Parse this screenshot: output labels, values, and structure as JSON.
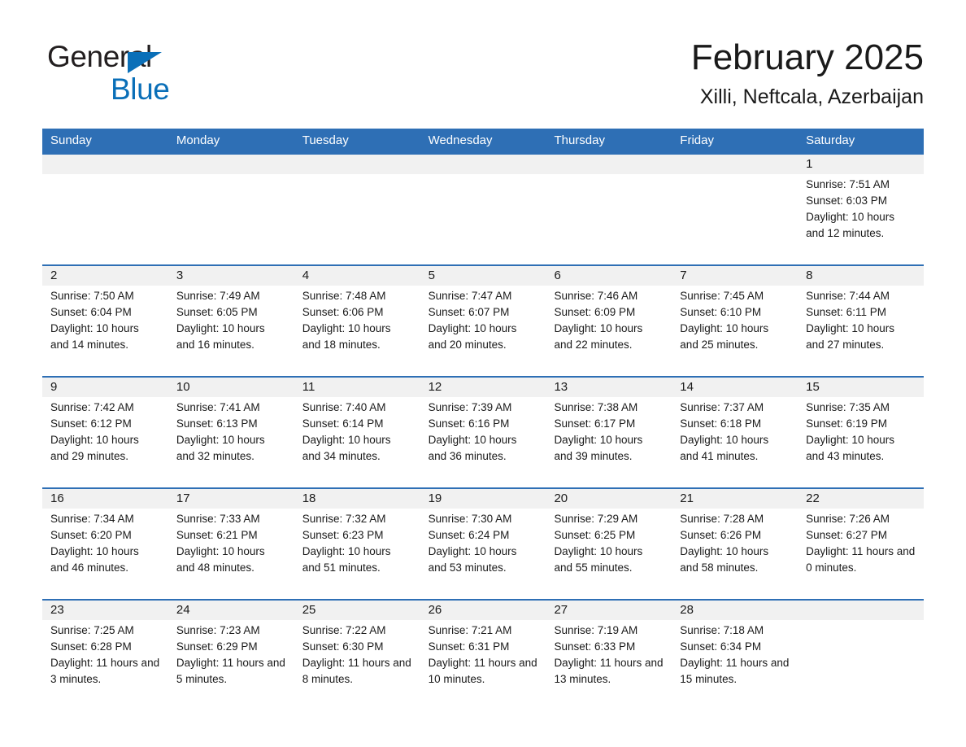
{
  "brand": {
    "name_part1": "General",
    "name_part2": "Blue",
    "triangle_color": "#0a6fb8"
  },
  "header": {
    "title": "February 2025",
    "subtitle": "Xilli, Neftcala, Azerbaijan",
    "accent_color": "#2e6fb5",
    "daynum_band_color": "#f1f1f1"
  },
  "weekdays": [
    "Sunday",
    "Monday",
    "Tuesday",
    "Wednesday",
    "Thursday",
    "Friday",
    "Saturday"
  ],
  "weeks": [
    {
      "days": [
        {
          "date": "",
          "sunrise": "",
          "sunset": "",
          "daylight": "",
          "empty": true
        },
        {
          "date": "",
          "sunrise": "",
          "sunset": "",
          "daylight": "",
          "empty": true
        },
        {
          "date": "",
          "sunrise": "",
          "sunset": "",
          "daylight": "",
          "empty": true
        },
        {
          "date": "",
          "sunrise": "",
          "sunset": "",
          "daylight": "",
          "empty": true
        },
        {
          "date": "",
          "sunrise": "",
          "sunset": "",
          "daylight": "",
          "empty": true
        },
        {
          "date": "",
          "sunrise": "",
          "sunset": "",
          "daylight": "",
          "empty": true
        },
        {
          "date": "1",
          "sunrise": "Sunrise: 7:51 AM",
          "sunset": "Sunset: 6:03 PM",
          "daylight": "Daylight: 10 hours and 12 minutes.",
          "empty": false
        }
      ]
    },
    {
      "days": [
        {
          "date": "2",
          "sunrise": "Sunrise: 7:50 AM",
          "sunset": "Sunset: 6:04 PM",
          "daylight": "Daylight: 10 hours and 14 minutes.",
          "empty": false
        },
        {
          "date": "3",
          "sunrise": "Sunrise: 7:49 AM",
          "sunset": "Sunset: 6:05 PM",
          "daylight": "Daylight: 10 hours and 16 minutes.",
          "empty": false
        },
        {
          "date": "4",
          "sunrise": "Sunrise: 7:48 AM",
          "sunset": "Sunset: 6:06 PM",
          "daylight": "Daylight: 10 hours and 18 minutes.",
          "empty": false
        },
        {
          "date": "5",
          "sunrise": "Sunrise: 7:47 AM",
          "sunset": "Sunset: 6:07 PM",
          "daylight": "Daylight: 10 hours and 20 minutes.",
          "empty": false
        },
        {
          "date": "6",
          "sunrise": "Sunrise: 7:46 AM",
          "sunset": "Sunset: 6:09 PM",
          "daylight": "Daylight: 10 hours and 22 minutes.",
          "empty": false
        },
        {
          "date": "7",
          "sunrise": "Sunrise: 7:45 AM",
          "sunset": "Sunset: 6:10 PM",
          "daylight": "Daylight: 10 hours and 25 minutes.",
          "empty": false
        },
        {
          "date": "8",
          "sunrise": "Sunrise: 7:44 AM",
          "sunset": "Sunset: 6:11 PM",
          "daylight": "Daylight: 10 hours and 27 minutes.",
          "empty": false
        }
      ]
    },
    {
      "days": [
        {
          "date": "9",
          "sunrise": "Sunrise: 7:42 AM",
          "sunset": "Sunset: 6:12 PM",
          "daylight": "Daylight: 10 hours and 29 minutes.",
          "empty": false
        },
        {
          "date": "10",
          "sunrise": "Sunrise: 7:41 AM",
          "sunset": "Sunset: 6:13 PM",
          "daylight": "Daylight: 10 hours and 32 minutes.",
          "empty": false
        },
        {
          "date": "11",
          "sunrise": "Sunrise: 7:40 AM",
          "sunset": "Sunset: 6:14 PM",
          "daylight": "Daylight: 10 hours and 34 minutes.",
          "empty": false
        },
        {
          "date": "12",
          "sunrise": "Sunrise: 7:39 AM",
          "sunset": "Sunset: 6:16 PM",
          "daylight": "Daylight: 10 hours and 36 minutes.",
          "empty": false
        },
        {
          "date": "13",
          "sunrise": "Sunrise: 7:38 AM",
          "sunset": "Sunset: 6:17 PM",
          "daylight": "Daylight: 10 hours and 39 minutes.",
          "empty": false
        },
        {
          "date": "14",
          "sunrise": "Sunrise: 7:37 AM",
          "sunset": "Sunset: 6:18 PM",
          "daylight": "Daylight: 10 hours and 41 minutes.",
          "empty": false
        },
        {
          "date": "15",
          "sunrise": "Sunrise: 7:35 AM",
          "sunset": "Sunset: 6:19 PM",
          "daylight": "Daylight: 10 hours and 43 minutes.",
          "empty": false
        }
      ]
    },
    {
      "days": [
        {
          "date": "16",
          "sunrise": "Sunrise: 7:34 AM",
          "sunset": "Sunset: 6:20 PM",
          "daylight": "Daylight: 10 hours and 46 minutes.",
          "empty": false
        },
        {
          "date": "17",
          "sunrise": "Sunrise: 7:33 AM",
          "sunset": "Sunset: 6:21 PM",
          "daylight": "Daylight: 10 hours and 48 minutes.",
          "empty": false
        },
        {
          "date": "18",
          "sunrise": "Sunrise: 7:32 AM",
          "sunset": "Sunset: 6:23 PM",
          "daylight": "Daylight: 10 hours and 51 minutes.",
          "empty": false
        },
        {
          "date": "19",
          "sunrise": "Sunrise: 7:30 AM",
          "sunset": "Sunset: 6:24 PM",
          "daylight": "Daylight: 10 hours and 53 minutes.",
          "empty": false
        },
        {
          "date": "20",
          "sunrise": "Sunrise: 7:29 AM",
          "sunset": "Sunset: 6:25 PM",
          "daylight": "Daylight: 10 hours and 55 minutes.",
          "empty": false
        },
        {
          "date": "21",
          "sunrise": "Sunrise: 7:28 AM",
          "sunset": "Sunset: 6:26 PM",
          "daylight": "Daylight: 10 hours and 58 minutes.",
          "empty": false
        },
        {
          "date": "22",
          "sunrise": "Sunrise: 7:26 AM",
          "sunset": "Sunset: 6:27 PM",
          "daylight": "Daylight: 11 hours and 0 minutes.",
          "empty": false
        }
      ]
    },
    {
      "days": [
        {
          "date": "23",
          "sunrise": "Sunrise: 7:25 AM",
          "sunset": "Sunset: 6:28 PM",
          "daylight": "Daylight: 11 hours and 3 minutes.",
          "empty": false
        },
        {
          "date": "24",
          "sunrise": "Sunrise: 7:23 AM",
          "sunset": "Sunset: 6:29 PM",
          "daylight": "Daylight: 11 hours and 5 minutes.",
          "empty": false
        },
        {
          "date": "25",
          "sunrise": "Sunrise: 7:22 AM",
          "sunset": "Sunset: 6:30 PM",
          "daylight": "Daylight: 11 hours and 8 minutes.",
          "empty": false
        },
        {
          "date": "26",
          "sunrise": "Sunrise: 7:21 AM",
          "sunset": "Sunset: 6:31 PM",
          "daylight": "Daylight: 11 hours and 10 minutes.",
          "empty": false
        },
        {
          "date": "27",
          "sunrise": "Sunrise: 7:19 AM",
          "sunset": "Sunset: 6:33 PM",
          "daylight": "Daylight: 11 hours and 13 minutes.",
          "empty": false
        },
        {
          "date": "28",
          "sunrise": "Sunrise: 7:18 AM",
          "sunset": "Sunset: 6:34 PM",
          "daylight": "Daylight: 11 hours and 15 minutes.",
          "empty": false
        },
        {
          "date": "",
          "sunrise": "",
          "sunset": "",
          "daylight": "",
          "empty": true
        }
      ]
    }
  ]
}
